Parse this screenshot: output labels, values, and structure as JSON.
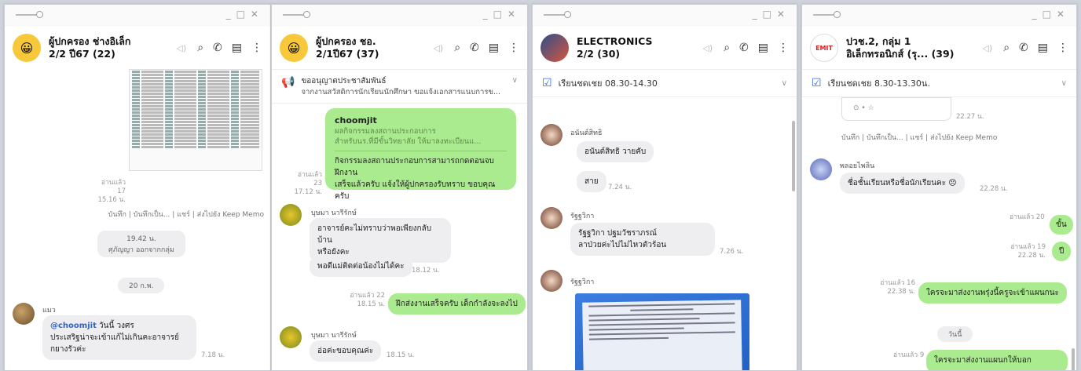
{
  "windows": [
    {
      "title1": "ผู้ปกครอง ช่างอิเล็ก",
      "title2": "2/2 ปี67 (22)",
      "read1": "อ่านแล้ว 17",
      "time1": "15.16 น.",
      "memo": "บันทึก | บันทึกเป็น... | แชร์ | ส่งไปยัง Keep Memo",
      "time2": "19.42 น.",
      "sub2": "ศุภัญญา ออกจากกลุ่ม",
      "date": "20 ก.พ.",
      "sender": "แมว",
      "mention": "@choomjit",
      "msg1": " วันนี้ วงศร",
      "msg2": "ประเสริฐน่าจะเข้าแก้ไม่เกินคะอาจารย์",
      "msg3": "กยางรัวค่ะ",
      "time3": "7.18 น."
    },
    {
      "title1": "ผู้ปกครอง ชอ.",
      "title2": "2/1ปี67 (37)",
      "ann1": "ขออนุญาตประชาสัมพันธ์",
      "ann2": "จากงานสวัสดิการนักเรียนนักศึกษา ขอแจ้งเอกสารแนบการข...",
      "q_name": "choomjit",
      "q1": "ผลกิจกรรมลงสถานประกอบการ",
      "q2": "สำหรับนร.ที่มีขั้นวิทยาลัย ให้มาลงทะเบียนแ...",
      "g1a": "กิจกรรมลงสถานประกอบการสามารถกดตอนจบฝึกงาน",
      "g1b": "เสร็จแล้วครับ แจ้งให้ผู้ปกครองรับทราบ ขอบคุณครับ",
      "read1": "อ่านแล้ว 23",
      "time1": "17.12 น.",
      "sender": "บุษมา นารีรักษ์",
      "m1a": "อาจารย์คะไม่ทราบว่าพอเพียงกลับบ้าน",
      "m1b": "หรือยังคะ",
      "m2": "พอดีแม่ติดต่อน้องไม่ได้คะ",
      "time2": "18.12 น.",
      "read2": "อ่านแล้ว 22",
      "time3": "18.15 น.",
      "g2": "ฝึกส่งงานเสร็จครับ เด็กกำลังจะลงไป",
      "sender2": "บุษมา นารีรักษ์",
      "m3": "อ่อค่ะขอบคุณค่ะ",
      "time4": "18.15 น."
    },
    {
      "title1": "ELECTRONICS",
      "title2": "2/2 (30)",
      "bar": "เรียนชดเชย 08.30-14.30",
      "s1": "อนันต์สิทธิ",
      "m1": "อนันต์สิทธิ วายคับ",
      "m2": "สาย",
      "t1": "7.24 น.",
      "s2": "รัฐฐวิกา",
      "m3a": "รัฐฐวิกา  ปฐมวัชราภรณ์",
      "m3b": "ลาป่วยค่ะไปไม่ไหวตัวร้อน",
      "t2": "7.26 น.",
      "s3": "รัฐฐวิกา"
    },
    {
      "title1": "ปวช.2, กลุ่ม 1",
      "title2": "อิเล็กทรอนิกส์ (รุ... (39)",
      "logo": "EMIT",
      "bar": "เรียนชดเชย 8.30-13.30น.",
      "t0": "22.27 น.",
      "memo": "บันทึก | บันทึกเป็น... | แชร์ | ส่งไปยัง Keep Memo",
      "s1": "พลอยไพลิน",
      "m1": "ชื่อชั้นเรียนหรือชื่อนักเรียนคะ 😣",
      "t1": "22.28 น.",
      "r1": "อ่านแล้ว 20",
      "g1": "ขั้น",
      "r2": "อ่านแล้ว 19",
      "t2": "22.28 น.",
      "g2": "ปี",
      "r3": "อ่านแล้ว 16",
      "t3": "22.38 น.",
      "g3": "ใครจะมาส่งงานพรุ่งนี้ครูจะเข้าแผนกนะ",
      "date": "วันนี้",
      "r4": "อ่านแล้ว 9",
      "g4": "ใครจะมาส่งงานแผนกให้บอก"
    }
  ]
}
